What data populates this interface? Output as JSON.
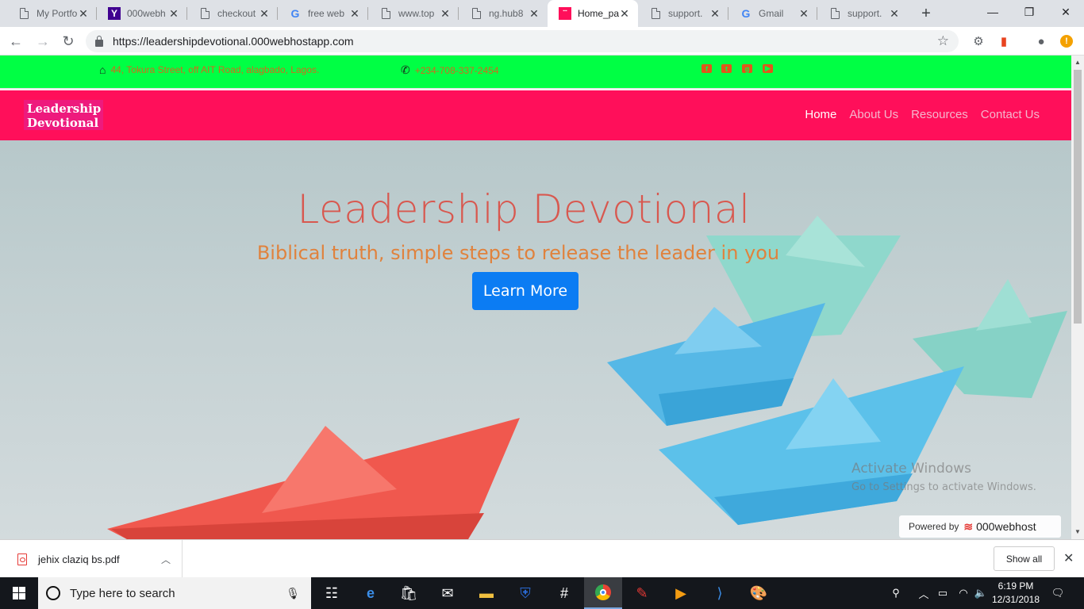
{
  "browser": {
    "tabs": [
      {
        "title": "My Portfo",
        "icon": "page-icon"
      },
      {
        "title": "000webh",
        "icon": "yahoo-icon"
      },
      {
        "title": "checkout",
        "icon": "page-icon"
      },
      {
        "title": "free web",
        "icon": "google-icon"
      },
      {
        "title": "www.top",
        "icon": "page-icon"
      },
      {
        "title": "ng.hub8",
        "icon": "page-icon"
      },
      {
        "title": "Home_pa",
        "icon": "site-favicon",
        "active": true
      },
      {
        "title": "support.",
        "icon": "page-icon"
      },
      {
        "title": "Gmail",
        "icon": "google-icon"
      },
      {
        "title": "support.",
        "icon": "page-icon"
      }
    ],
    "url": "https://leadershipdevotional.000webhostapp.com"
  },
  "site": {
    "topbar": {
      "address": "44, Tokura Street, off AIT Road, alagbado, Lagos.",
      "phone": "+234-708-337-2454",
      "social": [
        "facebook-icon",
        "twitter-icon",
        "google-plus-icon",
        "youtube-icon"
      ]
    },
    "brand_line1": "Leadership",
    "brand_line2": "Devotional",
    "nav": [
      "Home",
      "About Us",
      "Resources",
      "Contact Us"
    ],
    "hero": {
      "title": "Leadership Devotional",
      "subtitle": "Biblical truth, simple steps to release the leader in you",
      "button": "Learn More"
    },
    "powered_by": "Powered by",
    "host_brand": "000webhost"
  },
  "watermark": {
    "line1": "Activate Windows",
    "line2": "Go to Settings to activate Windows."
  },
  "downloads": {
    "file": "jehix claziq bs.pdf",
    "show_all": "Show all"
  },
  "taskbar": {
    "search_placeholder": "Type here to search",
    "time": "6:19 PM",
    "date": "12/31/2018"
  },
  "colors": {
    "topbar_bg": "#00ff44",
    "navbar_bg": "#ff0f5a",
    "hero_title": "#d8584f",
    "hero_subtitle": "#e0823d",
    "button_bg": "#0b7cf3"
  }
}
